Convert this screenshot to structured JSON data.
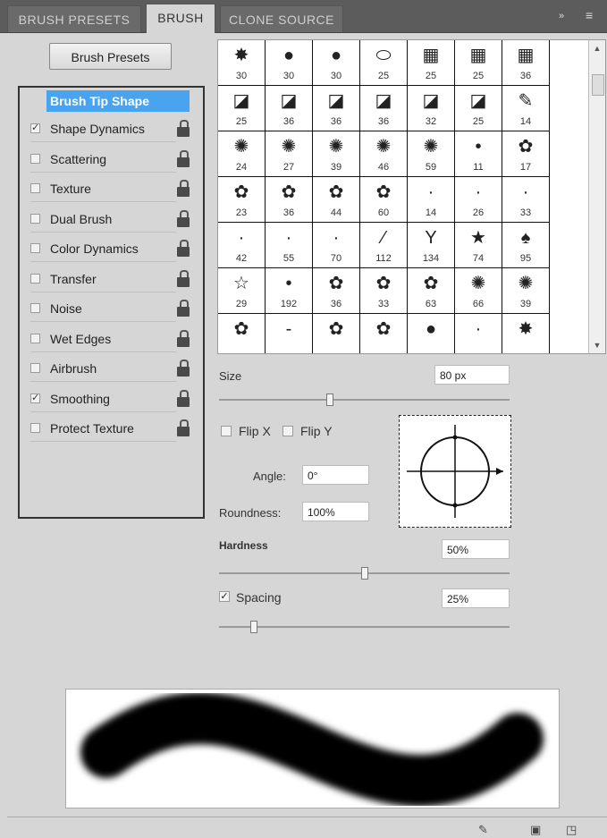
{
  "tabs": [
    "BRUSH PRESETS",
    "BRUSH",
    "CLONE SOURCE"
  ],
  "tabbar_controls": "»",
  "brush_presets_button": "Brush Presets",
  "options": {
    "header": "Brush Tip Shape",
    "items": [
      {
        "label": "Shape Dynamics",
        "checked": true
      },
      {
        "label": "Scattering",
        "checked": false
      },
      {
        "label": "Texture",
        "checked": false
      },
      {
        "label": "Dual Brush",
        "checked": false
      },
      {
        "label": "Color Dynamics",
        "checked": false
      },
      {
        "label": "Transfer",
        "checked": false
      },
      {
        "label": "Noise",
        "checked": false
      },
      {
        "label": "Wet Edges",
        "checked": false
      },
      {
        "label": "Airbrush",
        "checked": false
      },
      {
        "label": "Smoothing",
        "checked": true
      },
      {
        "label": "Protect Texture",
        "checked": false
      }
    ]
  },
  "brush_sizes": [
    "30",
    "30",
    "30",
    "25",
    "25",
    "25",
    "36",
    "25",
    "36",
    "36",
    "36",
    "32",
    "25",
    "14",
    "24",
    "27",
    "39",
    "46",
    "59",
    "11",
    "17",
    "23",
    "36",
    "44",
    "60",
    "14",
    "26",
    "33",
    "42",
    "55",
    "70",
    "112",
    "134",
    "74",
    "95",
    "29",
    "192",
    "36",
    "33",
    "63",
    "66",
    "39",
    "",
    "",
    "",
    "",
    "",
    "",
    ""
  ],
  "brush_glyphs": [
    "✸",
    "●",
    "●",
    "⬭",
    "▦",
    "▦",
    "▦",
    "◪",
    "◪",
    "◪",
    "◪",
    "◪",
    "◪",
    "✎",
    "✺",
    "✺",
    "✺",
    "✺",
    "✺",
    "•",
    "✿",
    "✿",
    "✿",
    "✿",
    "✿",
    "·",
    "·",
    "·",
    "·",
    "·",
    "·",
    "⁄",
    "Y",
    "★",
    "♠",
    "☆",
    "•",
    "✿",
    "✿",
    "✿",
    "✺",
    "✺",
    "✿",
    "-",
    "✿",
    "✿",
    "●",
    "·",
    "✸"
  ],
  "controls": {
    "size_label": "Size",
    "size_value": "80 px",
    "size_fraction": 0.38,
    "flip_x_label": "Flip X",
    "flip_y_label": "Flip Y",
    "angle_label": "Angle:",
    "angle_value": "0°",
    "roundness_label": "Roundness:",
    "roundness_value": "100%",
    "hardness_label": "Hardness",
    "hardness_value": "50%",
    "hardness_fraction": 0.5,
    "spacing_label": "Spacing",
    "spacing_checked": true,
    "spacing_value": "25%",
    "spacing_fraction": 0.12
  },
  "icons": {
    "tab_menu": "double-chevron-icon",
    "footer": [
      "brush-toggle-icon",
      "panel-icon",
      "new-icon"
    ]
  }
}
